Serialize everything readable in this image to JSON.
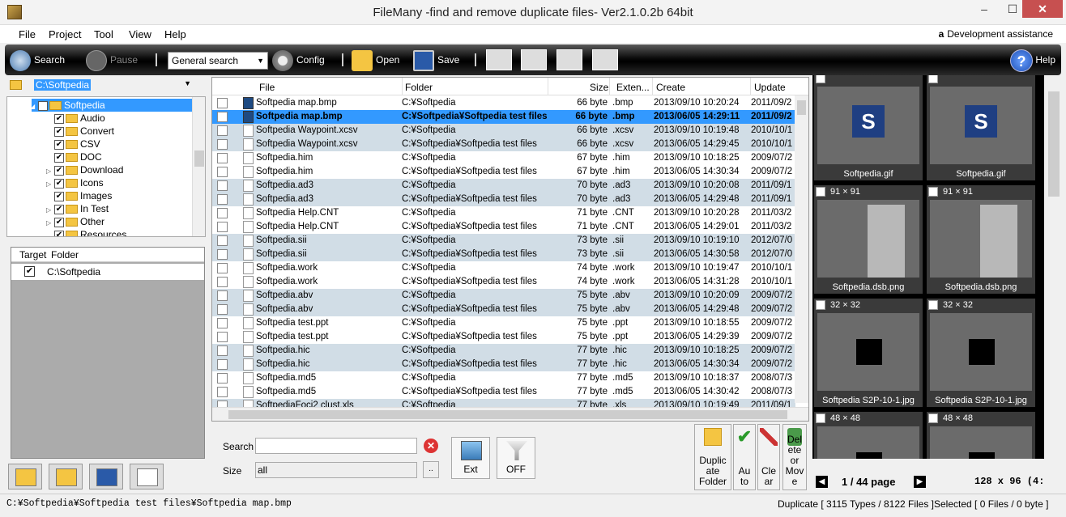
{
  "window": {
    "title": "FileMany -find and remove duplicate files- Ver2.1.0.2b 64bit",
    "min": "–",
    "max": "☐",
    "close": "✕"
  },
  "menu": {
    "items": [
      "File",
      "Project",
      "Tool",
      "View",
      "Help"
    ],
    "dev_assist_logo": "a",
    "dev_assist": "Development assistance"
  },
  "toolbar": {
    "search": "Search",
    "pause": "Pause",
    "search_mode": "General search",
    "config": "Config",
    "open": "Open",
    "save": "Save",
    "help": "Help",
    "help_glyph": "?"
  },
  "folder_combo": {
    "value": "C:\\Softpedia"
  },
  "tree": {
    "root": "Softpedia",
    "items": [
      "Audio",
      "Convert",
      "CSV",
      "DOC",
      "Download",
      "Icons",
      "Images",
      "In Test",
      "Other",
      "Resources"
    ],
    "expanders": [
      "",
      "",
      "",
      "",
      "▷",
      "▷",
      "",
      "▷",
      "▷",
      ""
    ]
  },
  "target": {
    "col_target": "Target",
    "col_folder": "Folder",
    "row_folder": "C:\\Softpedia",
    "check": "✔"
  },
  "grid": {
    "columns": {
      "file": "File",
      "folder": "Folder",
      "size": "Size",
      "ext": "Exten...",
      "create": "Create",
      "update": "Update"
    },
    "rows": [
      {
        "file": "Softpedia map.bmp",
        "folder": "C:¥Softpedia",
        "size": "66 byte",
        "ext": ".bmp",
        "create": "2013/09/10 10:20:24",
        "update": "2011/09/2",
        "img": true
      },
      {
        "file": "Softpedia map.bmp",
        "folder": "C:¥Softpedia¥Softpedia test files",
        "size": "66 byte",
        "ext": ".bmp",
        "create": "2013/06/05 14:29:11",
        "update": "2011/09/2",
        "img": true
      },
      {
        "file": "Softpedia Waypoint.xcsv",
        "folder": "C:¥Softpedia",
        "size": "66 byte",
        "ext": ".xcsv",
        "create": "2013/09/10 10:19:48",
        "update": "2010/10/1"
      },
      {
        "file": "Softpedia Waypoint.xcsv",
        "folder": "C:¥Softpedia¥Softpedia test files",
        "size": "66 byte",
        "ext": ".xcsv",
        "create": "2013/06/05 14:29:45",
        "update": "2010/10/1"
      },
      {
        "file": "Softpedia.him",
        "folder": "C:¥Softpedia",
        "size": "67 byte",
        "ext": ".him",
        "create": "2013/09/10 10:18:25",
        "update": "2009/07/2"
      },
      {
        "file": "Softpedia.him",
        "folder": "C:¥Softpedia¥Softpedia test files",
        "size": "67 byte",
        "ext": ".him",
        "create": "2013/06/05 14:30:34",
        "update": "2009/07/2"
      },
      {
        "file": "Softpedia.ad3",
        "folder": "C:¥Softpedia",
        "size": "70 byte",
        "ext": ".ad3",
        "create": "2013/09/10 10:20:08",
        "update": "2011/09/1"
      },
      {
        "file": "Softpedia.ad3",
        "folder": "C:¥Softpedia¥Softpedia test files",
        "size": "70 byte",
        "ext": ".ad3",
        "create": "2013/06/05 14:29:48",
        "update": "2011/09/1"
      },
      {
        "file": "Softpedia Help.CNT",
        "folder": "C:¥Softpedia",
        "size": "71 byte",
        "ext": ".CNT",
        "create": "2013/09/10 10:20:28",
        "update": "2011/03/2"
      },
      {
        "file": "Softpedia Help.CNT",
        "folder": "C:¥Softpedia¥Softpedia test files",
        "size": "71 byte",
        "ext": ".CNT",
        "create": "2013/06/05 14:29:01",
        "update": "2011/03/2"
      },
      {
        "file": "Softpedia.sii",
        "folder": "C:¥Softpedia",
        "size": "73 byte",
        "ext": ".sii",
        "create": "2013/09/10 10:19:10",
        "update": "2012/07/0"
      },
      {
        "file": "Softpedia.sii",
        "folder": "C:¥Softpedia¥Softpedia test files",
        "size": "73 byte",
        "ext": ".sii",
        "create": "2013/06/05 14:30:58",
        "update": "2012/07/0"
      },
      {
        "file": "Softpedia.work",
        "folder": "C:¥Softpedia",
        "size": "74 byte",
        "ext": ".work",
        "create": "2013/09/10 10:19:47",
        "update": "2010/10/1"
      },
      {
        "file": "Softpedia.work",
        "folder": "C:¥Softpedia¥Softpedia test files",
        "size": "74 byte",
        "ext": ".work",
        "create": "2013/06/05 14:31:28",
        "update": "2010/10/1"
      },
      {
        "file": "Softpedia.abv",
        "folder": "C:¥Softpedia",
        "size": "75 byte",
        "ext": ".abv",
        "create": "2013/09/10 10:20:09",
        "update": "2009/07/2"
      },
      {
        "file": "Softpedia.abv",
        "folder": "C:¥Softpedia¥Softpedia test files",
        "size": "75 byte",
        "ext": ".abv",
        "create": "2013/06/05 14:29:48",
        "update": "2009/07/2"
      },
      {
        "file": "Softpedia test.ppt",
        "folder": "C:¥Softpedia",
        "size": "75 byte",
        "ext": ".ppt",
        "create": "2013/09/10 10:18:55",
        "update": "2009/07/2"
      },
      {
        "file": "Softpedia test.ppt",
        "folder": "C:¥Softpedia¥Softpedia test files",
        "size": "75 byte",
        "ext": ".ppt",
        "create": "2013/06/05 14:29:39",
        "update": "2009/07/2"
      },
      {
        "file": "Softpedia.hic",
        "folder": "C:¥Softpedia",
        "size": "77 byte",
        "ext": ".hic",
        "create": "2013/09/10 10:18:25",
        "update": "2009/07/2"
      },
      {
        "file": "Softpedia.hic",
        "folder": "C:¥Softpedia¥Softpedia test files",
        "size": "77 byte",
        "ext": ".hic",
        "create": "2013/06/05 14:30:34",
        "update": "2009/07/2"
      },
      {
        "file": "Softpedia.md5",
        "folder": "C:¥Softpedia",
        "size": "77 byte",
        "ext": ".md5",
        "create": "2013/09/10 10:18:37",
        "update": "2008/07/3"
      },
      {
        "file": "Softpedia.md5",
        "folder": "C:¥Softpedia¥Softpedia test files",
        "size": "77 byte",
        "ext": ".md5",
        "create": "2013/06/05 14:30:42",
        "update": "2008/07/3"
      },
      {
        "file": "SoftpediaFoci2 clust.xls",
        "folder": "C:¥Softpedia",
        "size": "77 byte",
        "ext": ".xls",
        "create": "2013/09/10 10:19:49",
        "update": "2011/09/1"
      }
    ]
  },
  "filters": {
    "search_label": "Search",
    "size_label": "Size",
    "size_value": "all",
    "clear_glyph": "✕",
    "more_glyph": "..",
    "ext_button": "Ext",
    "off_button": "OFF"
  },
  "actions": {
    "duplicate_folder": [
      "Duplic",
      "ate",
      "Folder"
    ],
    "auto": [
      "Au",
      "to"
    ],
    "clear": [
      "Cle",
      "ar"
    ],
    "delete_move": [
      "Del",
      "ete",
      "or",
      "Mov",
      "e"
    ]
  },
  "thumbs": [
    {
      "dims": "",
      "name": "Softpedia.gif",
      "kind": "logo",
      "logo": "S"
    },
    {
      "dims": "",
      "name": "Softpedia.gif",
      "kind": "logo",
      "logo": "S"
    },
    {
      "dims": "91 × 91",
      "name": "Softpedia.dsb.png",
      "kind": "bar"
    },
    {
      "dims": "91 × 91",
      "name": "Softpedia.dsb.png",
      "kind": "bar"
    },
    {
      "dims": "32 × 32",
      "name": "Softpedia S2P-10-1.jpg",
      "kind": "sq"
    },
    {
      "dims": "32 × 32",
      "name": "Softpedia S2P-10-1.jpg",
      "kind": "sq"
    },
    {
      "dims": "48 × 48",
      "name": "",
      "kind": "sq"
    },
    {
      "dims": "48 × 48",
      "name": "",
      "kind": "sq"
    }
  ],
  "pager": {
    "prev": "◀",
    "next": "▶",
    "text": "1 / 44 page",
    "thumb_size": "128 x 96 (4:"
  },
  "status": {
    "path": "C:¥Softpedia¥Softpedia test files¥Softpedia map.bmp",
    "duplicate": "Duplicate [ 3115 Types / 8122 Files ]",
    "selected": "Selected [ 0 Files / 0 byte ]"
  },
  "colors": {
    "selection": "#3399ff",
    "row_alt": "#d1dde6",
    "close": "#c75050",
    "logo_bg": "#1f3f82"
  }
}
